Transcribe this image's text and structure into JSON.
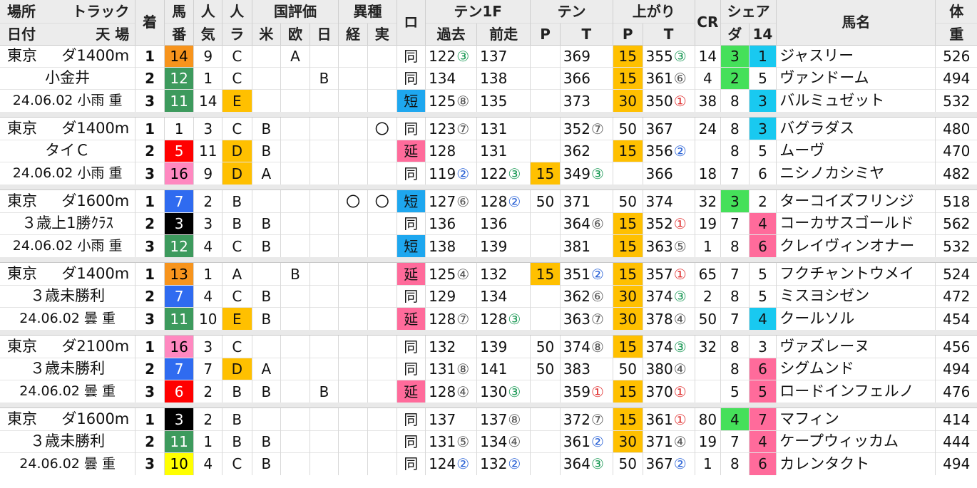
{
  "header": {
    "row1": {
      "basho": "場所",
      "track": "トラック",
      "chaku": "着",
      "uma": "馬",
      "nin": "人",
      "nin_ra": "人",
      "kokuhyoka": "国評価",
      "ishu": "異種",
      "ro": "ロ",
      "ten1f": "テン1F",
      "ten": "テン",
      "agari": "上がり",
      "cr": "CR",
      "share": "シェア",
      "bamei": "馬名",
      "tai": "体"
    },
    "row2": {
      "hizuke": "日付",
      "tenba": "天 場",
      "ban": "番",
      "ki": "気",
      "ra": "ラ",
      "bei": "米",
      "ou": "欧",
      "nichi": "日",
      "kei": "経",
      "jitsu": "実",
      "kako": "過去",
      "zenso": "前走",
      "ten_p": "P",
      "ten_t": "T",
      "agari_p": "P",
      "agari_t": "T",
      "da": "ダ",
      "s14": "14",
      "ju": "重"
    }
  },
  "colors": {
    "orange": "#f7941d",
    "green": "#3d9a5d",
    "yellow_e": "#ffd700",
    "red": "#ff0000",
    "pink": "#ff88c0",
    "blue": "#2f6bf0",
    "black": "#000000",
    "yellow10": "#ffff00",
    "white": "#ffffff",
    "gold": "#ffc000",
    "cyan": "#19c9f0",
    "lime": "#45e05a",
    "rose": "#ff6b9b",
    "ro_short": "#1ea7ef",
    "ro_long": "#ff6b9b"
  },
  "races": [
    {
      "venue": "東京",
      "track": "ダ1400m",
      "class": "小金井",
      "date": "24.06.02 小雨 重",
      "rows": [
        {
          "rank": "1",
          "ban": "14",
          "ban_color": "orange",
          "ban_text": "black",
          "ninki": "9",
          "ra": "C",
          "ra_bg": "",
          "bei": "",
          "ou": "A",
          "nichi": "",
          "kei": "",
          "jitsu": "",
          "ro": "同",
          "ro_bg": "",
          "kako": "122",
          "kako_m": "③",
          "kako_mc": "c1",
          "zenso": "137",
          "zenso_m": "",
          "zenso_mc": "",
          "tp": "",
          "tp_bg": "",
          "tt": "369",
          "tt_m": "",
          "tt_mc": "",
          "ap": "15",
          "ap_bg": "gold",
          "at": "355",
          "at_m": "③",
          "at_mc": "c1",
          "cr": "14",
          "da": "3",
          "da_bg": "lime",
          "s14": "1",
          "s14_bg": "cyan",
          "name": "ジャスリー",
          "weight": "526"
        },
        {
          "rank": "2",
          "ban": "12",
          "ban_color": "green",
          "ban_text": "white",
          "ninki": "1",
          "ra": "C",
          "ra_bg": "",
          "bei": "",
          "ou": "",
          "nichi": "B",
          "kei": "",
          "jitsu": "",
          "ro": "同",
          "ro_bg": "",
          "kako": "134",
          "kako_m": "",
          "kako_mc": "",
          "zenso": "138",
          "zenso_m": "",
          "zenso_mc": "",
          "tp": "",
          "tp_bg": "",
          "tt": "366",
          "tt_m": "",
          "tt_mc": "",
          "ap": "15",
          "ap_bg": "gold",
          "at": "361",
          "at_m": "⑥",
          "at_mc": "cgray",
          "cr": "4",
          "da": "2",
          "da_bg": "lime",
          "s14": "5",
          "s14_bg": "",
          "name": "ヴァンドーム",
          "weight": "494"
        },
        {
          "rank": "3",
          "ban": "11",
          "ban_color": "green",
          "ban_text": "white",
          "ninki": "14",
          "ra": "E",
          "ra_bg": "gold",
          "bei": "",
          "ou": "",
          "nichi": "",
          "kei": "",
          "jitsu": "",
          "ro": "短",
          "ro_bg": "ro_short",
          "kako": "125",
          "kako_m": "⑧",
          "kako_mc": "cgray",
          "zenso": "135",
          "zenso_m": "",
          "zenso_mc": "",
          "tp": "",
          "tp_bg": "",
          "tt": "373",
          "tt_m": "",
          "tt_mc": "",
          "ap": "30",
          "ap_bg": "gold",
          "at": "350",
          "at_m": "①",
          "at_mc": "c1r",
          "cr": "38",
          "da": "8",
          "da_bg": "",
          "s14": "3",
          "s14_bg": "cyan",
          "name": "バルミュゼット",
          "weight": "532"
        }
      ]
    },
    {
      "venue": "東京",
      "track": "ダ1400m",
      "class": "タイＣ",
      "date": "24.06.02 小雨 重",
      "rows": [
        {
          "rank": "1",
          "ban": "1",
          "ban_color": "white",
          "ban_text": "black",
          "ninki": "3",
          "ra": "C",
          "ra_bg": "",
          "bei": "B",
          "ou": "",
          "nichi": "",
          "kei": "",
          "jitsu": "〇",
          "ro": "同",
          "ro_bg": "",
          "kako": "123",
          "kako_m": "⑦",
          "kako_mc": "cgray",
          "zenso": "131",
          "zenso_m": "",
          "zenso_mc": "",
          "tp": "",
          "tp_bg": "",
          "tt": "352",
          "tt_m": "⑦",
          "tt_mc": "cgray",
          "ap": "50",
          "ap_bg": "",
          "at": "367",
          "at_m": "",
          "at_mc": "",
          "cr": "24",
          "da": "8",
          "da_bg": "",
          "s14": "3",
          "s14_bg": "cyan",
          "name": "バグラダス",
          "weight": "480"
        },
        {
          "rank": "2",
          "ban": "5",
          "ban_color": "red",
          "ban_text": "white",
          "ninki": "11",
          "ra": "D",
          "ra_bg": "gold",
          "bei": "B",
          "ou": "",
          "nichi": "",
          "kei": "",
          "jitsu": "",
          "ro": "延",
          "ro_bg": "ro_long",
          "kako": "128",
          "kako_m": "",
          "kako_mc": "",
          "zenso": "131",
          "zenso_m": "",
          "zenso_mc": "",
          "tp": "",
          "tp_bg": "",
          "tt": "362",
          "tt_m": "",
          "tt_mc": "",
          "ap": "15",
          "ap_bg": "gold",
          "at": "356",
          "at_m": "②",
          "at_mc": "c2",
          "cr": "",
          "da": "8",
          "da_bg": "",
          "s14": "5",
          "s14_bg": "",
          "name": "ムーヴ",
          "weight": "470"
        },
        {
          "rank": "3",
          "ban": "16",
          "ban_color": "pink",
          "ban_text": "black",
          "ninki": "9",
          "ra": "D",
          "ra_bg": "gold",
          "bei": "A",
          "ou": "",
          "nichi": "",
          "kei": "",
          "jitsu": "",
          "ro": "同",
          "ro_bg": "",
          "kako": "119",
          "kako_m": "②",
          "kako_mc": "c2",
          "zenso": "122",
          "zenso_m": "③",
          "zenso_mc": "c1",
          "tp": "15",
          "tp_bg": "gold",
          "tt": "349",
          "tt_m": "③",
          "tt_mc": "c1",
          "ap": "",
          "ap_bg": "",
          "at": "366",
          "at_m": "",
          "at_mc": "",
          "cr": "18",
          "da": "7",
          "da_bg": "",
          "s14": "6",
          "s14_bg": "",
          "name": "ニシノカシミヤ",
          "weight": "482"
        }
      ]
    },
    {
      "venue": "東京",
      "track": "ダ1600m",
      "class": "３歳上1勝ｸﾗｽ",
      "date": "24.06.02 小雨 重",
      "rows": [
        {
          "rank": "1",
          "ban": "7",
          "ban_color": "blue",
          "ban_text": "white",
          "ninki": "2",
          "ra": "B",
          "ra_bg": "",
          "bei": "",
          "ou": "",
          "nichi": "",
          "kei": "〇",
          "jitsu": "〇",
          "ro": "短",
          "ro_bg": "ro_short",
          "kako": "127",
          "kako_m": "⑥",
          "kako_mc": "cgray",
          "zenso": "128",
          "zenso_m": "②",
          "zenso_mc": "c2",
          "tp": "50",
          "tp_bg": "",
          "tt": "371",
          "tt_m": "",
          "tt_mc": "",
          "ap": "50",
          "ap_bg": "",
          "at": "374",
          "at_m": "",
          "at_mc": "",
          "cr": "32",
          "da": "3",
          "da_bg": "lime",
          "s14": "2",
          "s14_bg": "",
          "name": "ターコイズフリンジ",
          "weight": "518"
        },
        {
          "rank": "2",
          "ban": "3",
          "ban_color": "black",
          "ban_text": "white",
          "ninki": "3",
          "ra": "B",
          "ra_bg": "",
          "bei": "B",
          "ou": "",
          "nichi": "",
          "kei": "",
          "jitsu": "",
          "ro": "同",
          "ro_bg": "",
          "kako": "136",
          "kako_m": "",
          "kako_mc": "",
          "zenso": "136",
          "zenso_m": "",
          "zenso_mc": "",
          "tp": "",
          "tp_bg": "",
          "tt": "364",
          "tt_m": "⑥",
          "tt_mc": "cgray",
          "ap": "15",
          "ap_bg": "gold",
          "at": "352",
          "at_m": "①",
          "at_mc": "c1r",
          "cr": "19",
          "da": "7",
          "da_bg": "",
          "s14": "4",
          "s14_bg": "rose",
          "name": "コーカサスゴールド",
          "weight": "562"
        },
        {
          "rank": "3",
          "ban": "12",
          "ban_color": "green",
          "ban_text": "white",
          "ninki": "4",
          "ra": "C",
          "ra_bg": "",
          "bei": "B",
          "ou": "",
          "nichi": "",
          "kei": "",
          "jitsu": "",
          "ro": "短",
          "ro_bg": "ro_short",
          "kako": "138",
          "kako_m": "",
          "kako_mc": "",
          "zenso": "139",
          "zenso_m": "",
          "zenso_mc": "",
          "tp": "",
          "tp_bg": "",
          "tt": "381",
          "tt_m": "",
          "tt_mc": "",
          "ap": "15",
          "ap_bg": "gold",
          "at": "363",
          "at_m": "⑤",
          "at_mc": "cgray",
          "cr": "1",
          "da": "8",
          "da_bg": "",
          "s14": "6",
          "s14_bg": "rose",
          "name": "クレイヴィンオナー",
          "weight": "532"
        }
      ]
    },
    {
      "venue": "東京",
      "track": "ダ1400m",
      "class": "３歳未勝利",
      "date": "24.06.02 曇 重",
      "rows": [
        {
          "rank": "1",
          "ban": "13",
          "ban_color": "orange",
          "ban_text": "black",
          "ninki": "1",
          "ra": "A",
          "ra_bg": "",
          "bei": "",
          "ou": "B",
          "nichi": "",
          "kei": "",
          "jitsu": "",
          "ro": "延",
          "ro_bg": "ro_long",
          "kako": "125",
          "kako_m": "④",
          "kako_mc": "cgray",
          "zenso": "132",
          "zenso_m": "",
          "zenso_mc": "",
          "tp": "15",
          "tp_bg": "gold",
          "tt": "351",
          "tt_m": "②",
          "tt_mc": "c2",
          "ap": "15",
          "ap_bg": "gold",
          "at": "357",
          "at_m": "①",
          "at_mc": "c1r",
          "cr": "65",
          "da": "7",
          "da_bg": "",
          "s14": "5",
          "s14_bg": "",
          "name": "フクチャントウメイ",
          "weight": "524"
        },
        {
          "rank": "2",
          "ban": "7",
          "ban_color": "blue",
          "ban_text": "white",
          "ninki": "4",
          "ra": "C",
          "ra_bg": "",
          "bei": "B",
          "ou": "",
          "nichi": "",
          "kei": "",
          "jitsu": "",
          "ro": "同",
          "ro_bg": "",
          "kako": "129",
          "kako_m": "",
          "kako_mc": "",
          "zenso": "134",
          "zenso_m": "",
          "zenso_mc": "",
          "tp": "",
          "tp_bg": "",
          "tt": "362",
          "tt_m": "⑥",
          "tt_mc": "cgray",
          "ap": "30",
          "ap_bg": "gold",
          "at": "374",
          "at_m": "③",
          "at_mc": "c1",
          "cr": "2",
          "da": "8",
          "da_bg": "",
          "s14": "5",
          "s14_bg": "",
          "name": "ミスヨシゼン",
          "weight": "472"
        },
        {
          "rank": "3",
          "ban": "11",
          "ban_color": "green",
          "ban_text": "white",
          "ninki": "10",
          "ra": "E",
          "ra_bg": "gold",
          "bei": "B",
          "ou": "",
          "nichi": "",
          "kei": "",
          "jitsu": "",
          "ro": "延",
          "ro_bg": "ro_long",
          "kako": "128",
          "kako_m": "⑦",
          "kako_mc": "cgray",
          "zenso": "128",
          "zenso_m": "③",
          "zenso_mc": "c1",
          "tp": "",
          "tp_bg": "",
          "tt": "363",
          "tt_m": "⑦",
          "tt_mc": "cgray",
          "ap": "30",
          "ap_bg": "gold",
          "at": "378",
          "at_m": "④",
          "at_mc": "cgray",
          "cr": "50",
          "da": "7",
          "da_bg": "",
          "s14": "4",
          "s14_bg": "cyan",
          "name": "クールソル",
          "weight": "454"
        }
      ]
    },
    {
      "venue": "東京",
      "track": "ダ2100m",
      "class": "３歳未勝利",
      "date": "24.06.02 曇 重",
      "rows": [
        {
          "rank": "1",
          "ban": "16",
          "ban_color": "pink",
          "ban_text": "black",
          "ninki": "3",
          "ra": "C",
          "ra_bg": "",
          "bei": "",
          "ou": "",
          "nichi": "",
          "kei": "",
          "jitsu": "",
          "ro": "同",
          "ro_bg": "",
          "kako": "132",
          "kako_m": "",
          "kako_mc": "",
          "zenso": "139",
          "zenso_m": "",
          "zenso_mc": "",
          "tp": "50",
          "tp_bg": "",
          "tt": "374",
          "tt_m": "⑧",
          "tt_mc": "cgray",
          "ap": "15",
          "ap_bg": "gold",
          "at": "374",
          "at_m": "③",
          "at_mc": "c1",
          "cr": "32",
          "da": "8",
          "da_bg": "",
          "s14": "3",
          "s14_bg": "",
          "name": "ヴァズレーヌ",
          "weight": "456"
        },
        {
          "rank": "2",
          "ban": "7",
          "ban_color": "blue",
          "ban_text": "white",
          "ninki": "7",
          "ra": "D",
          "ra_bg": "gold",
          "bei": "A",
          "ou": "",
          "nichi": "",
          "kei": "",
          "jitsu": "",
          "ro": "同",
          "ro_bg": "",
          "kako": "131",
          "kako_m": "⑧",
          "kako_mc": "cgray",
          "zenso": "141",
          "zenso_m": "",
          "zenso_mc": "",
          "tp": "50",
          "tp_bg": "",
          "tt": "383",
          "tt_m": "",
          "tt_mc": "",
          "ap": "50",
          "ap_bg": "",
          "at": "380",
          "at_m": "④",
          "at_mc": "cgray",
          "cr": "",
          "da": "8",
          "da_bg": "",
          "s14": "6",
          "s14_bg": "rose",
          "name": "シグムンド",
          "weight": "494"
        },
        {
          "rank": "3",
          "ban": "6",
          "ban_color": "red",
          "ban_text": "white",
          "ninki": "2",
          "ra": "B",
          "ra_bg": "",
          "bei": "B",
          "ou": "",
          "nichi": "B",
          "kei": "",
          "jitsu": "",
          "ro": "延",
          "ro_bg": "ro_long",
          "kako": "128",
          "kako_m": "④",
          "kako_mc": "cgray",
          "zenso": "130",
          "zenso_m": "③",
          "zenso_mc": "c1",
          "tp": "",
          "tp_bg": "",
          "tt": "359",
          "tt_m": "①",
          "tt_mc": "c1r",
          "ap": "15",
          "ap_bg": "gold",
          "at": "370",
          "at_m": "①",
          "at_mc": "c1r",
          "cr": "",
          "da": "5",
          "da_bg": "",
          "s14": "5",
          "s14_bg": "rose",
          "name": "ロードインフェルノ",
          "weight": "476"
        }
      ]
    },
    {
      "venue": "東京",
      "track": "ダ1600m",
      "class": "３歳未勝利",
      "date": "24.06.02 曇 重",
      "rows": [
        {
          "rank": "1",
          "ban": "3",
          "ban_color": "black",
          "ban_text": "white",
          "ninki": "2",
          "ra": "B",
          "ra_bg": "",
          "bei": "",
          "ou": "",
          "nichi": "",
          "kei": "",
          "jitsu": "",
          "ro": "同",
          "ro_bg": "",
          "kako": "137",
          "kako_m": "",
          "kako_mc": "",
          "zenso": "137",
          "zenso_m": "⑧",
          "zenso_mc": "cgray",
          "tp": "",
          "tp_bg": "",
          "tt": "372",
          "tt_m": "⑦",
          "tt_mc": "cgray",
          "ap": "15",
          "ap_bg": "gold",
          "at": "361",
          "at_m": "①",
          "at_mc": "c1r",
          "cr": "80",
          "da": "4",
          "da_bg": "lime",
          "s14": "7",
          "s14_bg": "rose",
          "name": "マフィン",
          "weight": "414"
        },
        {
          "rank": "2",
          "ban": "11",
          "ban_color": "green",
          "ban_text": "white",
          "ninki": "1",
          "ra": "B",
          "ra_bg": "",
          "bei": "B",
          "ou": "",
          "nichi": "",
          "kei": "",
          "jitsu": "",
          "ro": "同",
          "ro_bg": "",
          "kako": "131",
          "kako_m": "⑤",
          "kako_mc": "cgray",
          "zenso": "134",
          "zenso_m": "④",
          "zenso_mc": "cgray",
          "tp": "",
          "tp_bg": "",
          "tt": "361",
          "tt_m": "②",
          "tt_mc": "c2",
          "ap": "30",
          "ap_bg": "gold",
          "at": "371",
          "at_m": "④",
          "at_mc": "cgray",
          "cr": "19",
          "da": "7",
          "da_bg": "",
          "s14": "4",
          "s14_bg": "rose",
          "name": "ケープウィッカム",
          "weight": "444"
        },
        {
          "rank": "3",
          "ban": "10",
          "ban_color": "yellow10",
          "ban_text": "black",
          "ninki": "4",
          "ra": "C",
          "ra_bg": "",
          "bei": "B",
          "ou": "",
          "nichi": "",
          "kei": "",
          "jitsu": "",
          "ro": "同",
          "ro_bg": "",
          "kako": "124",
          "kako_m": "②",
          "kako_mc": "c2",
          "zenso": "132",
          "zenso_m": "②",
          "zenso_mc": "c2",
          "tp": "",
          "tp_bg": "",
          "tt": "364",
          "tt_m": "③",
          "tt_mc": "c1",
          "ap": "50",
          "ap_bg": "",
          "at": "367",
          "at_m": "②",
          "at_mc": "c2",
          "cr": "1",
          "da": "8",
          "da_bg": "",
          "s14": "6",
          "s14_bg": "rose",
          "name": "カレンタクト",
          "weight": "494"
        }
      ]
    }
  ]
}
